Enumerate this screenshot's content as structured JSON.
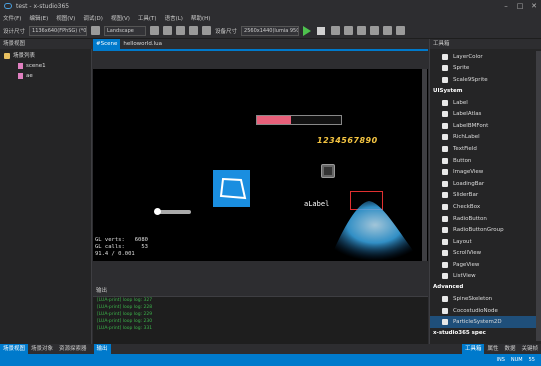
{
  "window": {
    "title": "test - x-studio365"
  },
  "menu": [
    "文件(F)",
    "编辑(E)",
    "视图(V)",
    "调试(D)",
    "视图(V)",
    "工具(T)",
    "语言(L)",
    "帮助(H)"
  ],
  "toolbar": {
    "design_size_label": "设计尺寸",
    "design_size_value": "1136x640(FPhSG) (*0.66",
    "orientation": "Landscape",
    "device_size_label": "设备尺寸",
    "device_size_value": "2560x1440(lumia 950XL)"
  },
  "left_panel": {
    "header": "场景视图",
    "tree": [
      {
        "label": "场景列表",
        "type": "folder"
      },
      {
        "label": "scene1",
        "type": "file"
      },
      {
        "label": "ae",
        "type": "file"
      }
    ]
  },
  "editor_tabs": [
    {
      "label": "#Scene",
      "active": true
    },
    {
      "label": "helloworld.lua",
      "active": false
    }
  ],
  "viewport": {
    "digits": "1234567890",
    "label": "aLabel",
    "stats": [
      "GL verts:   6080",
      "GL calls:     53",
      "91.4 / 0.001"
    ],
    "loading_progress": 0.4
  },
  "output": {
    "header": "输出",
    "lines": [
      "[LUA-print] loop log: 327",
      "[LUA-print] loop log: 228",
      "[LUA-print] loop log: 229",
      "[LUA-print] loop log: 230",
      "[LUA-print] loop log: 331"
    ]
  },
  "right_panel": {
    "header": "工具箱",
    "top_items": [
      "LayerColor",
      "Sprite",
      "Scale9Sprite"
    ],
    "groups": [
      {
        "name": "UISystem",
        "items": [
          "Label",
          "LabelAtlas",
          "LabelBMFont",
          "RichLabel",
          "TextField",
          "Button",
          "ImageView",
          "LoadingBar",
          "SliderBar",
          "CheckBox",
          "RadioButton",
          "RadioButtonGroup",
          "Layout",
          "ScrollView",
          "PageView",
          "ListView"
        ]
      },
      {
        "name": "Advanced",
        "items": [
          "SpineSkeleton",
          "CocostudioNode",
          "ParticleSystem2D"
        ]
      }
    ],
    "footer_group": "x-studio365 spec",
    "selected": "ParticleSystem2D"
  },
  "bottom_tabs": [
    {
      "label": "场景视图",
      "active": true
    },
    {
      "label": "场景对象",
      "active": false
    },
    {
      "label": "资源探索器",
      "active": false
    }
  ],
  "output_tab": "输出",
  "status": {
    "items": [
      "INS",
      "NUM",
      "55"
    ]
  },
  "right_bottom_tabs": [
    "工具箱",
    "属性",
    "数据",
    "关键帧"
  ],
  "colors": {
    "accent": "#007acc",
    "viewport_bg": "#000000",
    "selection": "#1f4f7a"
  }
}
